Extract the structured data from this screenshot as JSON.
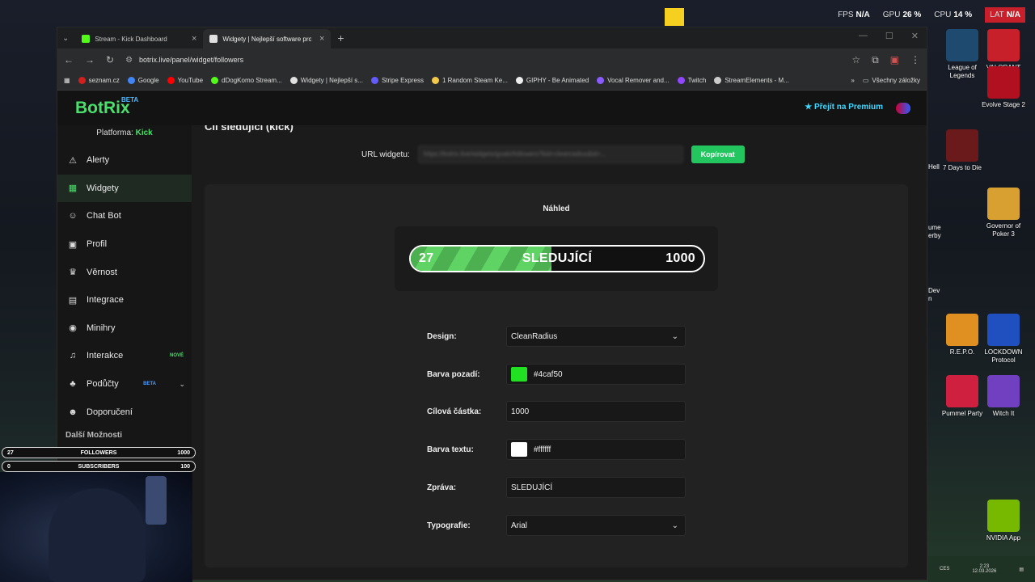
{
  "desktop": {
    "perf": [
      {
        "k": "FPS",
        "v": "N/A"
      },
      {
        "k": "GPU",
        "v": "26 %"
      },
      {
        "k": "CPU",
        "v": "14 %"
      },
      {
        "k": "LAT",
        "v": "N/A"
      }
    ],
    "icons": [
      {
        "label": "League of Legends",
        "color": "#1f4a70"
      },
      {
        "label": "VALORANT",
        "color": "#c8202a"
      },
      {
        "label": "Evolve Stage 2",
        "color": "#b01020"
      },
      {
        "label": "7 Days to Die",
        "color": "#6a1a1a"
      },
      {
        "label": "Governor of Poker 3",
        "color": "#d8a030"
      },
      {
        "label": "R.E.P.O.",
        "color": "#e09020"
      },
      {
        "label": "LOCKDOWN Protocol",
        "color": "#2050c0"
      },
      {
        "label": "Pummel Party",
        "color": "#d02040"
      },
      {
        "label": "Witch It",
        "color": "#7040c0"
      },
      {
        "label": "NVIDIA App",
        "color": "#76b900"
      }
    ],
    "partial_labels": [
      "Hell",
      "ume",
      "erby",
      "Dev",
      "n"
    ],
    "clock": {
      "time": "2:23",
      "date": "12.03.2026",
      "lang": "CES"
    }
  },
  "browser": {
    "tabs": [
      {
        "label": "Stream - Kick Dashboard",
        "fav": "#53fc18"
      },
      {
        "label": "Widgety | Nejlepší software pro",
        "fav": "#e0e0e0"
      }
    ],
    "url": "botrix.live/panel/widget/followers",
    "bookmarks": [
      {
        "label": "seznam.cz",
        "color": "#d02020"
      },
      {
        "label": "Google",
        "color": "#4285f4"
      },
      {
        "label": "YouTube",
        "color": "#ff0000"
      },
      {
        "label": "dDogKomo Stream...",
        "color": "#53fc18"
      },
      {
        "label": "Widgety | Nejlepší s...",
        "color": "#e0e0e0"
      },
      {
        "label": "Stripe Express",
        "color": "#635bff"
      },
      {
        "label": "1 Random Steam Ke...",
        "color": "#f2c94c"
      },
      {
        "label": "GIPHY - Be Animated",
        "color": "#eeeeee"
      },
      {
        "label": "Vocal Remover and...",
        "color": "#8a5cff"
      },
      {
        "label": "Twitch",
        "color": "#9146ff"
      },
      {
        "label": "StreamElements - M...",
        "color": "#cccccc"
      }
    ],
    "all_bookmarks": "Všechny záložky"
  },
  "app": {
    "logo": "BotRix",
    "logo_tag": "BETA",
    "premium": "Přejít na Premium",
    "platform_label": "Platforma:",
    "platform": "Kick",
    "nav": [
      {
        "label": "Alerty",
        "icon": "⚠"
      },
      {
        "label": "Widgety",
        "icon": "▦",
        "active": true
      },
      {
        "label": "Chat Bot",
        "icon": "☺"
      },
      {
        "label": "Profil",
        "icon": "▣"
      },
      {
        "label": "Věrnost",
        "icon": "♛"
      },
      {
        "label": "Integrace",
        "icon": "▤"
      },
      {
        "label": "Minihry",
        "icon": "◉"
      },
      {
        "label": "Interakce",
        "icon": "♫",
        "badge": "NOVÉ"
      },
      {
        "label": "Podůčty",
        "icon": "♣",
        "badge": "BETA",
        "chev": true
      },
      {
        "label": "Doporučení",
        "icon": "☻"
      }
    ],
    "more_label": "Další Možnosti",
    "page_title": "Cíl sledující (kick)",
    "url_label": "URL widgetu:",
    "url_value": "https://botrix.live/widgets/goals/followers?bid=cleanradius&id=...",
    "copy_label": "Kopírovat",
    "preview_label": "Náhled",
    "goal": {
      "current": "27",
      "message": "SLEDUJÍCÍ",
      "target": "1000",
      "progress_fraction": 0.48,
      "text_color": "#ffffff",
      "fill_color": "#4caf50"
    },
    "form": [
      {
        "label": "Design:",
        "value": "CleanRadius",
        "type": "select"
      },
      {
        "label": "Barva pozadí:",
        "value": "#4caf50",
        "type": "color",
        "swatch": "#22e022"
      },
      {
        "label": "Cílová částka:",
        "value": "1000",
        "type": "text"
      },
      {
        "label": "Barva textu:",
        "value": "#ffffff",
        "type": "color",
        "swatch": "#ffffff"
      },
      {
        "label": "Zpráva:",
        "value": "SLEDUJÍCÍ",
        "type": "text"
      },
      {
        "label": "Typografie:",
        "value": "Arial",
        "type": "select"
      }
    ]
  },
  "overlay": {
    "bars": [
      {
        "current": "27",
        "label": "FOLLOWERS",
        "goal": "1000"
      },
      {
        "current": "0",
        "label": "SUBSCRIBERS",
        "goal": "100"
      }
    ]
  }
}
